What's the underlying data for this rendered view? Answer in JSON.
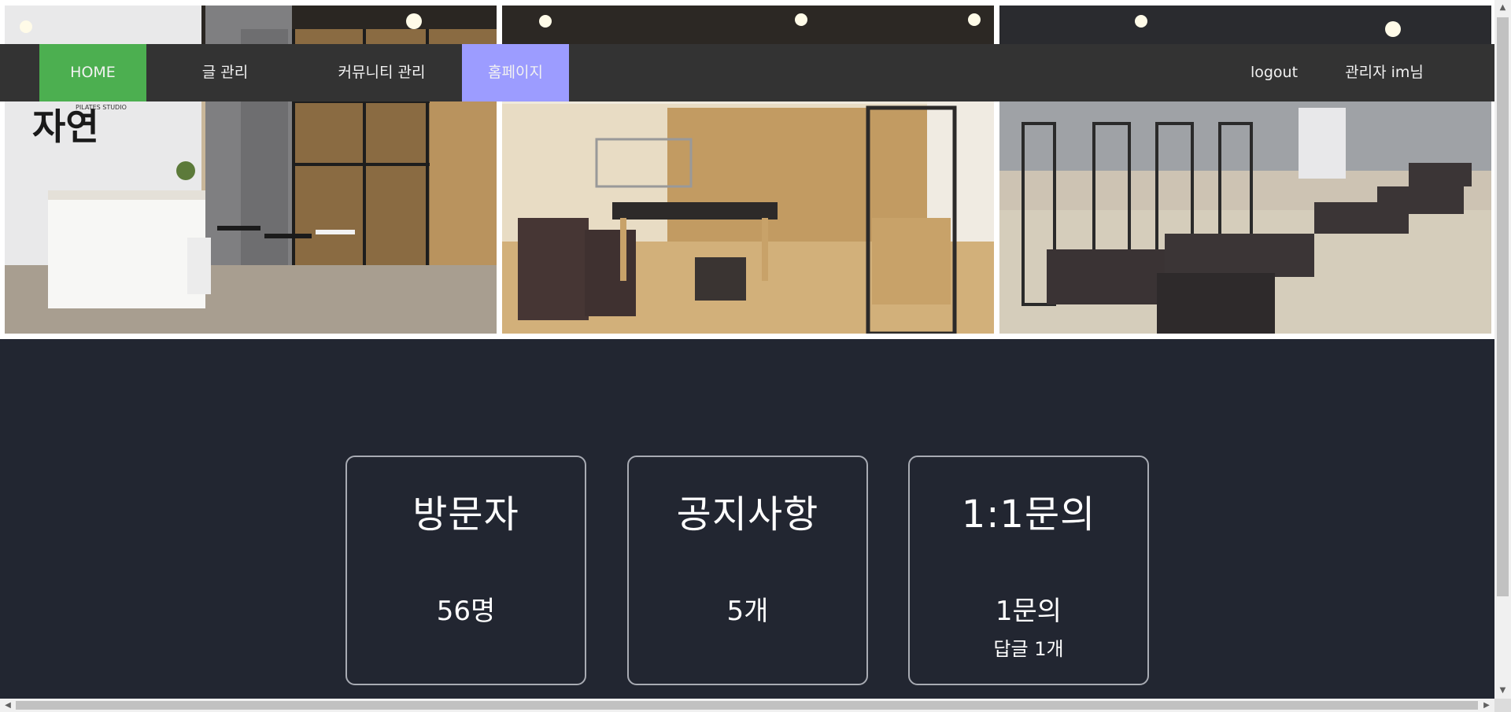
{
  "nav": {
    "home": "HOME",
    "posts": "글 관리",
    "community": "커뮤니티 관리",
    "homepage": "홈페이지",
    "logout": "logout",
    "admin": "관리자 im님"
  },
  "hero": {
    "logo_script": "자연",
    "logo_small": "PILATES STUDIO"
  },
  "cards": {
    "visitors": {
      "title": "방문자",
      "value": "56명"
    },
    "notices": {
      "title": "공지사항",
      "value": "5개"
    },
    "qna": {
      "title": "1:1문의",
      "value": "1문의",
      "sub": "답글 1개"
    }
  },
  "colors": {
    "nav_bg": "#333333",
    "home_active": "#4caf50",
    "homepage_highlight": "#9c9cff",
    "dashboard_bg": "#222631"
  }
}
